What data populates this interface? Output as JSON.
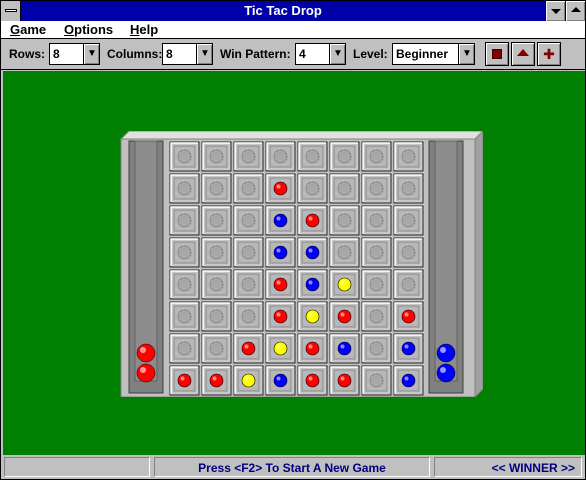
{
  "window": {
    "title": "Tic Tac Drop"
  },
  "menu": {
    "items": [
      {
        "label": "Game",
        "accel": "G",
        "rest": "ame"
      },
      {
        "label": "Options",
        "accel": "O",
        "rest": "ptions"
      },
      {
        "label": "Help",
        "accel": "H",
        "rest": "elp"
      }
    ]
  },
  "toolbar": {
    "rows_label": "Rows:",
    "rows_value": "8",
    "columns_label": "Columns:",
    "columns_value": "8",
    "win_label": "Win Pattern:",
    "win_value": "4",
    "level_label": "Level:",
    "level_value": "Beginner",
    "buttons": [
      {
        "name": "stop-button",
        "icon": "stop-icon"
      },
      {
        "name": "eject-button",
        "icon": "eject-icon"
      },
      {
        "name": "hint-button",
        "icon": "cross-icon"
      }
    ]
  },
  "colors": {
    "red": "#ff0000",
    "blue": "#0000ff",
    "yellow": "#ffff00",
    "empty": "#a8a8a8",
    "felt": "#008000",
    "title": "#0000a8"
  },
  "board": {
    "rows": 8,
    "columns": 8,
    "cells": [
      [
        "",
        "",
        "",
        "",
        "",
        "",
        "",
        ""
      ],
      [
        "",
        "",
        "",
        "R",
        "",
        "",
        "",
        ""
      ],
      [
        "",
        "",
        "",
        "B",
        "R",
        "",
        "",
        ""
      ],
      [
        "",
        "",
        "",
        "B",
        "B",
        "",
        "",
        ""
      ],
      [
        "",
        "",
        "",
        "R",
        "B",
        "Y",
        "",
        ""
      ],
      [
        "",
        "",
        "",
        "R",
        "Y",
        "R",
        "",
        "R"
      ],
      [
        "",
        "",
        "R",
        "Y",
        "R",
        "B",
        "",
        "B"
      ],
      [
        "R",
        "R",
        "Y",
        "B",
        "R",
        "R",
        "",
        "B"
      ]
    ],
    "left_tray": [
      "R",
      "R"
    ],
    "right_tray": [
      "B",
      "B"
    ]
  },
  "status": {
    "left": "",
    "message": "Press <F2> To Start A New Game",
    "right": "<< WINNER >>"
  }
}
